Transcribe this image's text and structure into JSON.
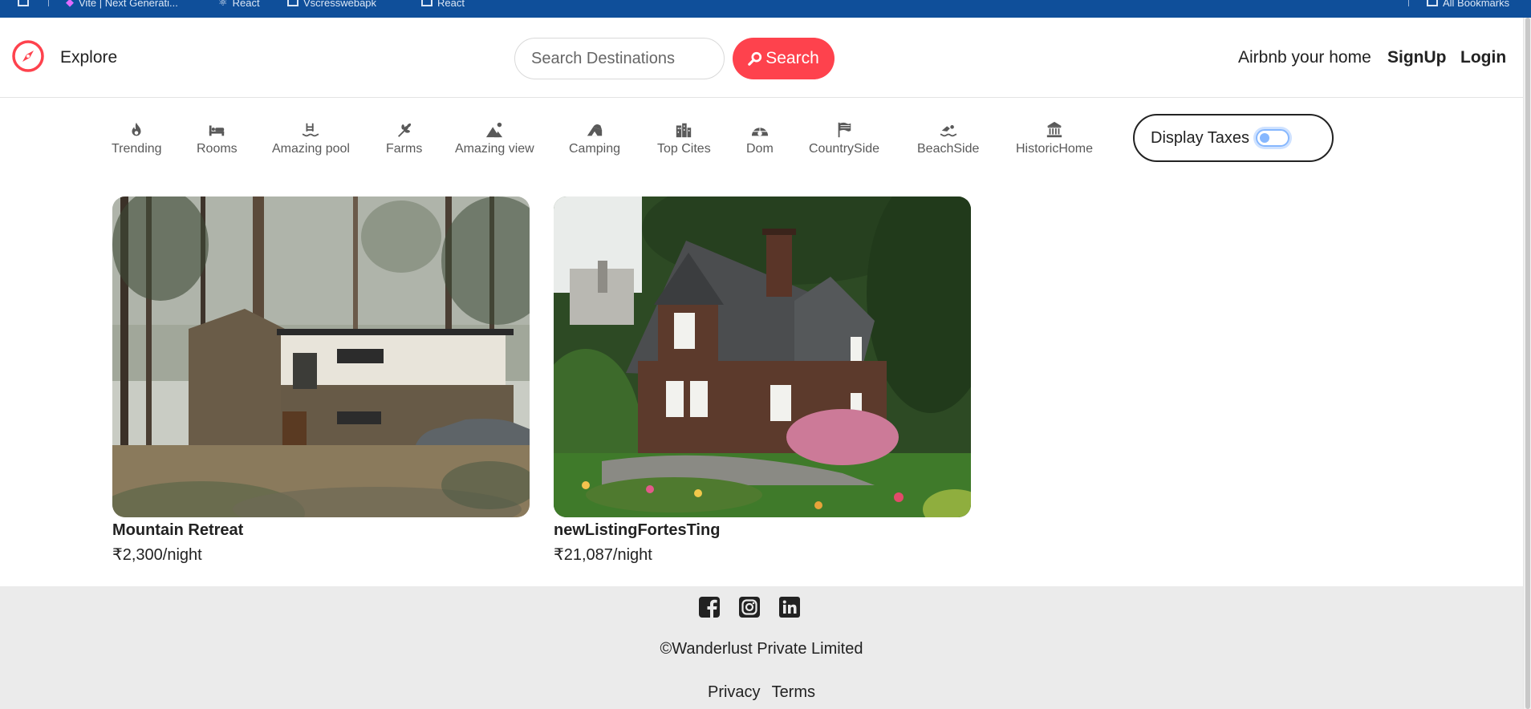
{
  "bookmarks": [
    "Vite | Next Generati...",
    "React",
    "Vscresswebapk",
    "React"
  ],
  "bookmarks_right": "All Bookmarks",
  "navbar": {
    "explore_label": "Explore",
    "search_placeholder": "Search Destinations",
    "search_button": "Search",
    "airbnb_home": "Airbnb your home",
    "signup": "SignUp",
    "login": "Login",
    "accent_color": "#fe424d"
  },
  "filters": [
    {
      "label": "Trending",
      "icon": "fire-icon"
    },
    {
      "label": "Rooms",
      "icon": "bed-icon"
    },
    {
      "label": "Amazing pool",
      "icon": "pool-icon"
    },
    {
      "label": "Farms",
      "icon": "wheat-icon"
    },
    {
      "label": "Amazing view",
      "icon": "mountain-sun-icon"
    },
    {
      "label": "Camping",
      "icon": "campground-icon"
    },
    {
      "label": "Top Cites",
      "icon": "city-icon"
    },
    {
      "label": "Dom",
      "icon": "igloo-icon"
    },
    {
      "label": "CountrySide",
      "icon": "flag-icon"
    },
    {
      "label": "BeachSide",
      "icon": "swimmer-icon"
    },
    {
      "label": "HistoricHome",
      "icon": "landmark-icon"
    }
  ],
  "tax_toggle": {
    "label": "Display Taxes",
    "checked": false
  },
  "listings": [
    {
      "title": "Mountain Retreat",
      "price": "₹2,300/night"
    },
    {
      "title": "newListingFortesTing",
      "price": "₹21,087/night"
    }
  ],
  "footer": {
    "social": [
      "facebook-icon",
      "instagram-icon",
      "linkedin-icon"
    ],
    "copyright": "©Wanderlust Private Limited",
    "privacy": "Privacy",
    "terms": "Terms"
  }
}
